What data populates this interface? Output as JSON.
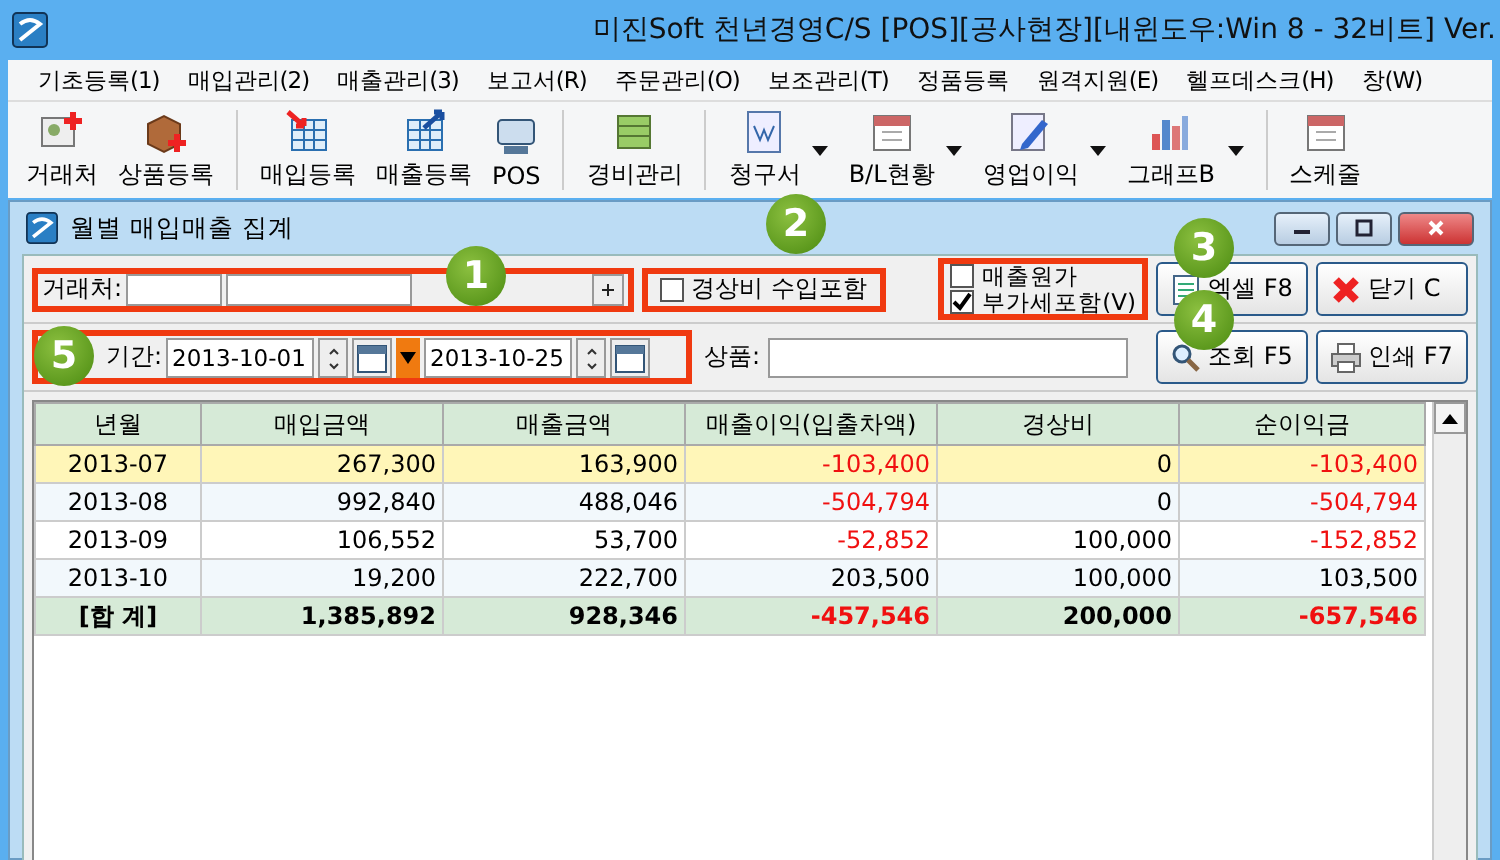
{
  "window": {
    "title": "미진Soft 천년경영C/S [POS][공사현장][내윈도우:Win 8 - 32비트] Ver."
  },
  "menu": [
    "기초등록(1)",
    "매입관리(2)",
    "매출관리(3)",
    "보고서(R)",
    "주문관리(O)",
    "보조관리(T)",
    "정품등록",
    "원격지원(E)",
    "헬프데스크(H)",
    "창(W)"
  ],
  "toolbar": [
    {
      "label": "거래처",
      "has_menu": false
    },
    {
      "label": "상품등록",
      "has_menu": false
    },
    {
      "label": "매입등록",
      "has_menu": false
    },
    {
      "label": "매출등록",
      "has_menu": false
    },
    {
      "label": "POS",
      "has_menu": false
    },
    {
      "label": "경비관리",
      "has_menu": false
    },
    {
      "label": "청구서",
      "has_menu": true
    },
    {
      "label": "B/L현황",
      "has_menu": true
    },
    {
      "label": "영업이익",
      "has_menu": true
    },
    {
      "label": "그래프B",
      "has_menu": true
    },
    {
      "label": "스케줄",
      "has_menu": false
    }
  ],
  "child_window": {
    "title": "월별 매입매출 집계"
  },
  "filters": {
    "client_label": "거래처:",
    "expense_checkbox": {
      "label": "경상비 수입포함",
      "checked": false
    },
    "cost_checkbox": {
      "label": "매출원가",
      "checked": false
    },
    "vat_checkbox": {
      "label": "부가세포함(V)",
      "checked": true
    },
    "period_label": "기간:",
    "date_from": "2013-10-01",
    "date_to": "2013-10-25",
    "product_label": "상품:"
  },
  "buttons": [
    "엑셀 F8",
    "닫기 C",
    "조회 F5",
    "인쇄 F7"
  ],
  "table": {
    "columns": [
      "년월",
      "매입금액",
      "매출금액",
      "매출이익(입출차액)",
      "경상비",
      "순이익금"
    ],
    "rows": [
      {
        "kind": "data",
        "selected": true,
        "cells": [
          "2013-07",
          "267,300",
          "163,900",
          "-103,400",
          "0",
          "-103,400"
        ]
      },
      {
        "kind": "data",
        "selected": false,
        "cells": [
          "2013-08",
          "992,840",
          "488,046",
          "-504,794",
          "0",
          "-504,794"
        ]
      },
      {
        "kind": "data",
        "selected": false,
        "cells": [
          "2013-09",
          "106,552",
          "53,700",
          "-52,852",
          "100,000",
          "-152,852"
        ]
      },
      {
        "kind": "data",
        "selected": false,
        "cells": [
          "2013-10",
          "19,200",
          "222,700",
          "203,500",
          "100,000",
          "103,500"
        ]
      },
      {
        "kind": "total",
        "selected": false,
        "cells": [
          "[합 계]",
          "1,385,892",
          "928,346",
          "-457,546",
          "200,000",
          "-657,546"
        ]
      }
    ]
  },
  "callouts": [
    "1",
    "2",
    "3",
    "4",
    "5"
  ]
}
